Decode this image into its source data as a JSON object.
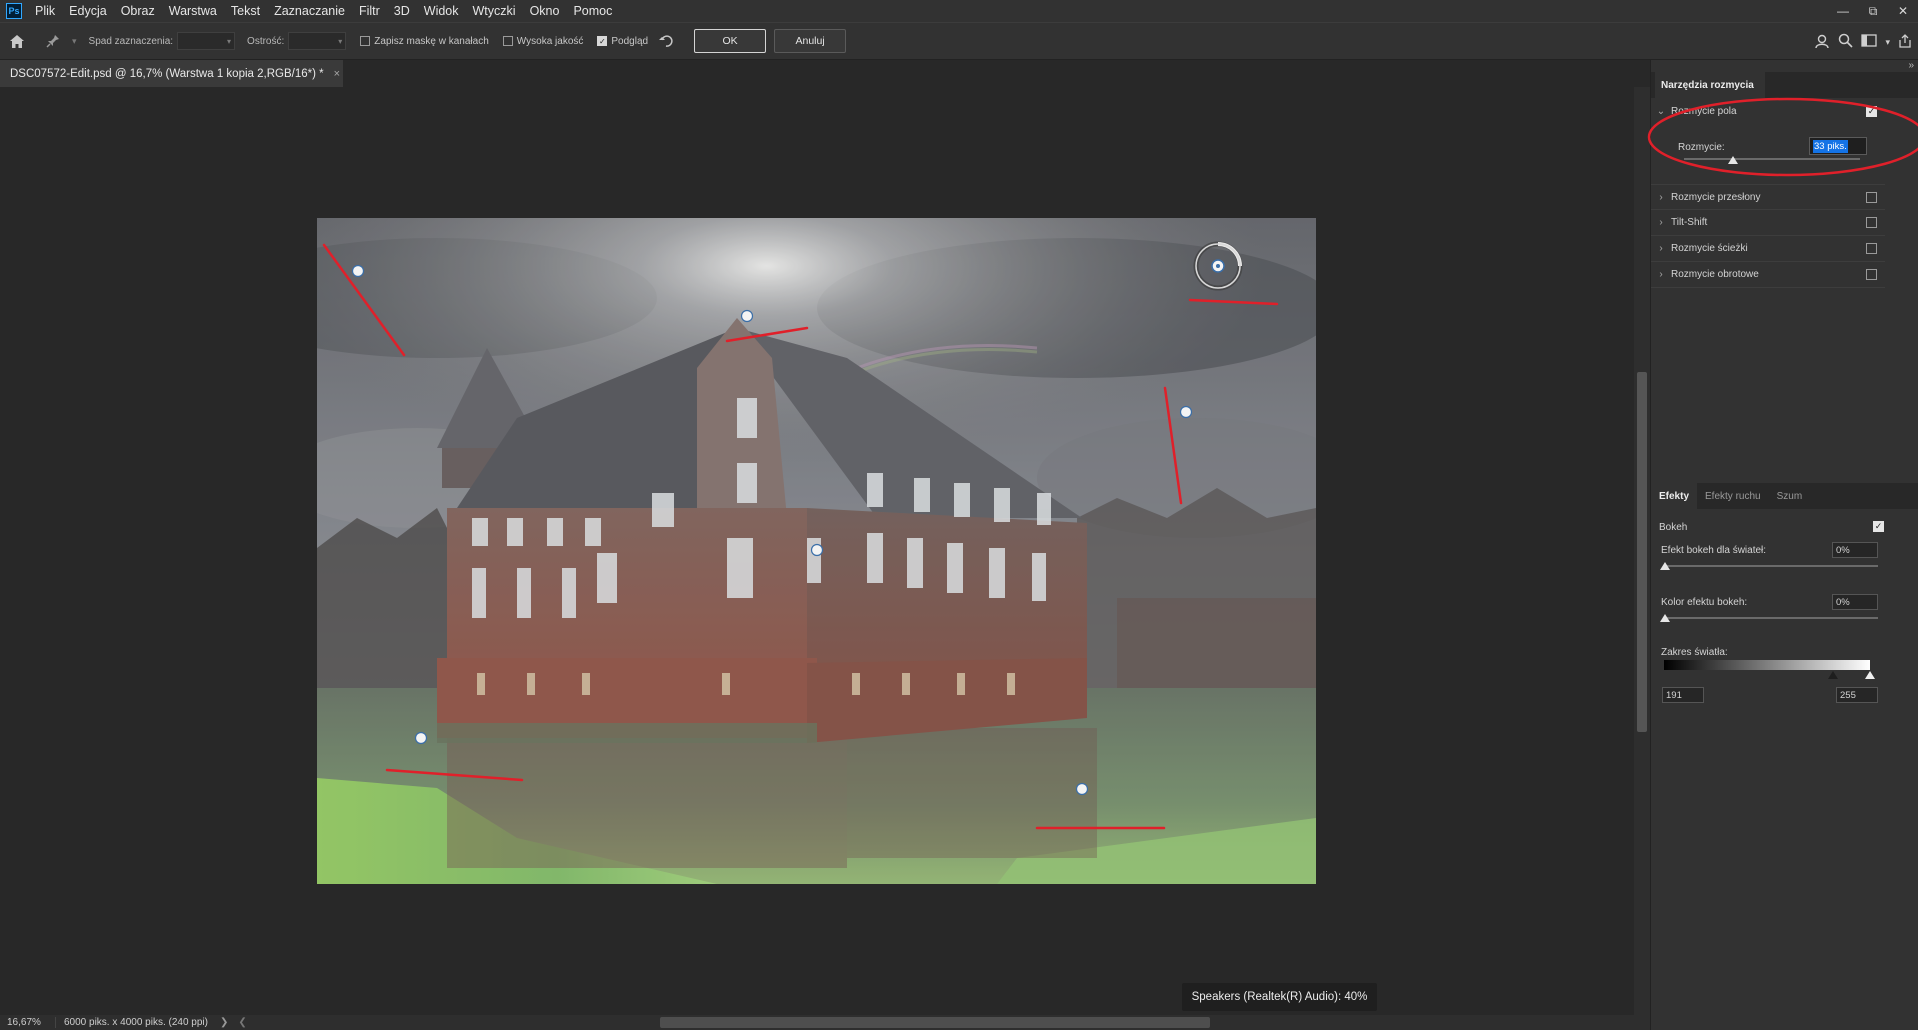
{
  "menu": [
    "Plik",
    "Edycja",
    "Obraz",
    "Warstwa",
    "Tekst",
    "Zaznaczanie",
    "Filtr",
    "3D",
    "Widok",
    "Wtyczki",
    "Okno",
    "Pomoc"
  ],
  "logo": "Ps",
  "options": {
    "selection_bleed_label": "Spad zaznaczenia:",
    "focus_label": "Ostrość:",
    "save_mask_label": "Zapisz maskę w kanałach",
    "save_mask_checked": false,
    "high_quality_label": "Wysoka jakość",
    "high_quality_checked": false,
    "preview_label": "Podgląd",
    "preview_checked": true,
    "ok_label": "OK",
    "cancel_label": "Anuluj"
  },
  "document": {
    "tab_title": "DSC07572-Edit.psd @ 16,7% (Warstwa 1 kopia 2,RGB/16*) *",
    "close_glyph": "×"
  },
  "status": {
    "zoom": "16,67%",
    "info": "6000 piks. x 4000 piks. (240 ppi)"
  },
  "toast": "Speakers (Realtek(R) Audio): 40%",
  "blur_tools": {
    "panel_title": "Narzędzia rozmycia",
    "field_blur": {
      "label": "Rozmycie pola",
      "checked": true
    },
    "blur_amount_label": "Rozmycie:",
    "blur_amount_value": "33 piks.",
    "blur_amount_fraction": 0.28,
    "others": [
      {
        "label": "Rozmycie przesłony",
        "checked": false
      },
      {
        "label": "Tilt-Shift",
        "checked": false
      },
      {
        "label": "Rozmycie ścieżki",
        "checked": false
      },
      {
        "label": "Rozmycie obrotowe",
        "checked": false
      }
    ]
  },
  "effects": {
    "tabs": [
      "Efekty",
      "Efekty ruchu",
      "Szum"
    ],
    "active_tab": "Efekty",
    "bokeh_label": "Bokeh",
    "bokeh_checked": true,
    "light_bokeh_label": "Efekt bokeh dla świateł:",
    "light_bokeh_value": "0%",
    "bokeh_color_label": "Kolor efektu bokeh:",
    "bokeh_color_value": "0%",
    "light_range_label": "Zakres światła:",
    "light_range_min": "191",
    "light_range_max": "255"
  },
  "colors": {
    "annotation_red": "#e0202a",
    "accent_blue": "#1473e6"
  }
}
